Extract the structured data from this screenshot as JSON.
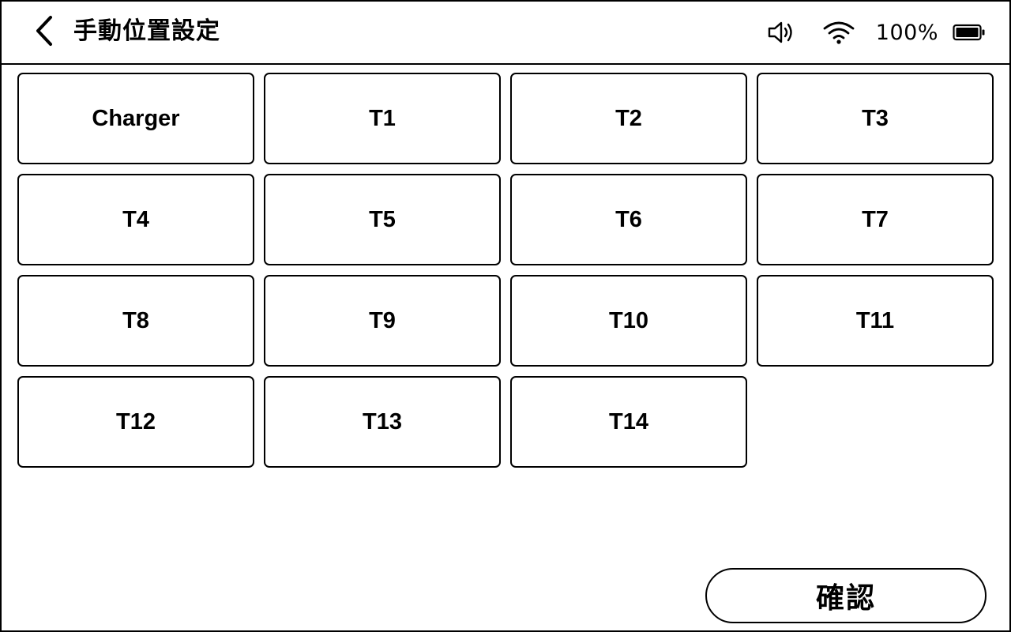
{
  "header": {
    "title": "手動位置設定",
    "back_icon": "chevron-left-icon",
    "status": {
      "volume_icon": "speaker-volume-icon",
      "wifi_icon": "wifi-icon",
      "battery_percent": "100%",
      "battery_level": 1.0,
      "battery_icon": "battery-icon"
    }
  },
  "locations": [
    "Charger",
    "T1",
    "T2",
    "T3",
    "T4",
    "T5",
    "T6",
    "T7",
    "T8",
    "T9",
    "T10",
    "T11",
    "T12",
    "T13",
    "T14"
  ],
  "footer": {
    "confirm_label": "確認"
  },
  "colors": {
    "foreground": "#000000",
    "background": "#ffffff"
  }
}
